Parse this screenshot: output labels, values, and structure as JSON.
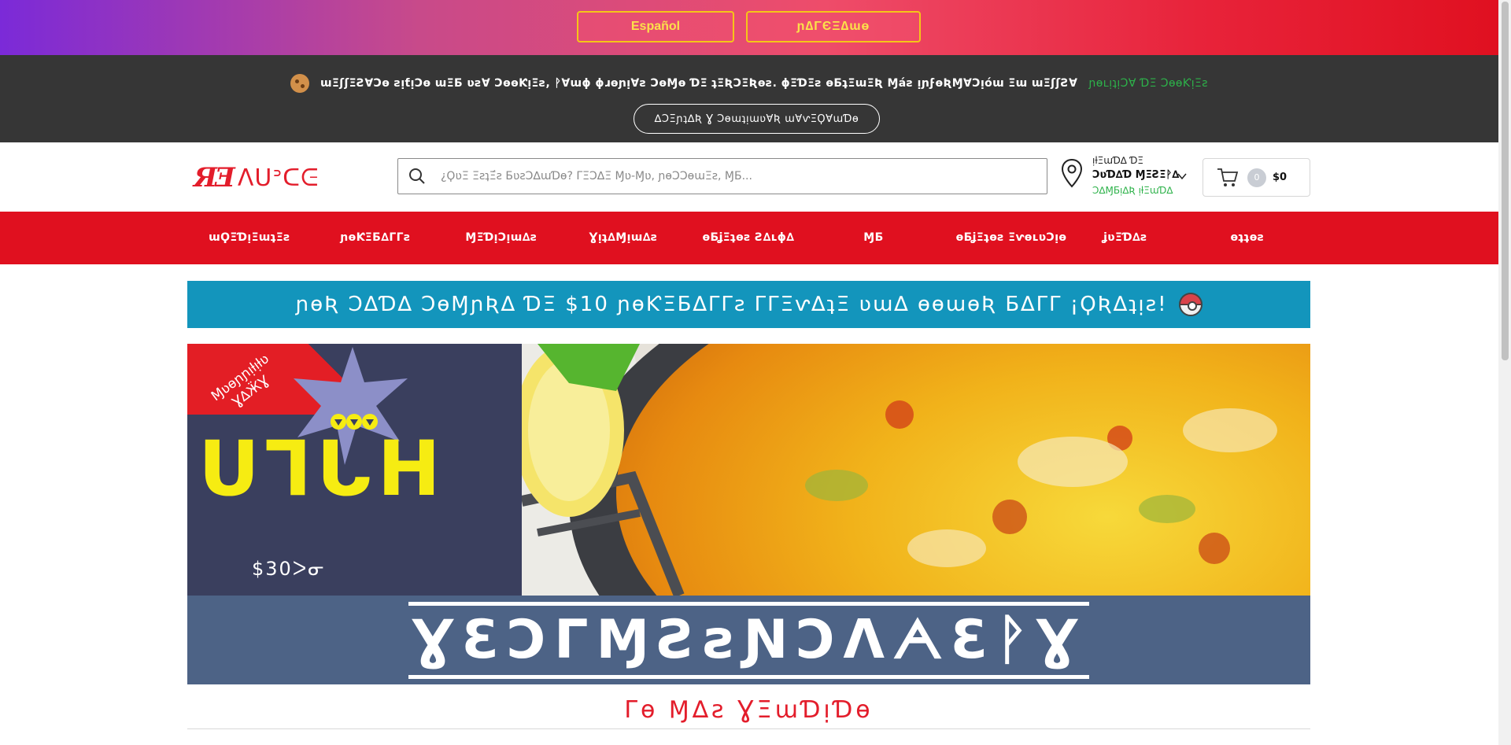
{
  "language_bar": {
    "spanish_label": "Español",
    "alt_label": "ɲ∆ΓЄΞ∆ɯɵ"
  },
  "cookie_banner": {
    "message": "ɯΞʃʃΞƧⱯƆɵ ƨᴉƭᴉƆɵ ɯΞƂ ʋƨⱯ ƆɵɵƘᴉΞƨ, ᚹⱯɯɸ ɸɹɵɲᴉⱯƨ ƆɵⱮɵ ƊΞ ʇΞƦƆΞƦɵƨ. ɸΞƊΞƨ ɵƂʇΞɯΞƦ Ɱáƨ ᴉɲϝɵƦⱮⱯƆᴉóɯ Ξɯ ɯΞʃʃƧⱯ",
    "policy_link": "ɲɵʟᴉʇᴉƆⱯ ƊΞ ƆɵɵƘᴉΞƨ",
    "accept_label": "∆ƆΞɲʇ∆Ʀ Ɣ ƆɵɯʇᴉɯʋⱯƦ ɯⱯⱱΞϘⱯɯƊɵ"
  },
  "header": {
    "logo_mark": "ЯƎ",
    "logo_text": "ᐱᑌᐣᑕᕮ",
    "search_placeholder": "¿ϘʋΞ ΞƨʇΞ́ƨ ƂʋƨƆ∆ɯƊɵ? ΓΞƆ∆Ξ Ɱʋ-Ɱʋ, ɲɵƆƆɵɯΞƨ, ⱮƂ...",
    "location_line1": "ᴉƚΞɯƊ∆ ƊΞ",
    "location_line2": "ƆʋƊ∆Ɗ ⱮΞƧΞᚹ∆",
    "location_change": "Ɔ∆ⱮƂᴉ∆Ʀ ᴉƚΞɯƊ∆",
    "cart_count": "0",
    "cart_total": "$0"
  },
  "nav": {
    "items": [
      "ɯϘΞƊᴉΞɯʇΞƨ",
      "ɲɵƘΞƂ∆ΓΓƨ",
      "ⱮΞƊᴉƆᴉɯ∆ƨ",
      "Ɣᴉʇ∆Ɱᴉɯ∆ƨ",
      "ɵƂʝΞʇɵƨ Ƨ∆ʟɸ∆",
      "ⱮƂ",
      "ɵƂʝΞʇɵƨ ΞⱱɵʟʋƆᴉɵ",
      "ʝʋΞƊ∆ƨ",
      "ɵʇʇɵƨ"
    ]
  },
  "promo": {
    "text": "ɲɵƦ Ɔ∆Ɗ∆ ƆɵⱮɲƦ∆ ƊΞ $10 ɲɵƘΞƂ∆ΓΓƨ ΓΓΞⱱ∆ʇΞ ʋɯ∆ ɵɵɯɵƦ Ƃ∆ΓΓ ¡ϘƦ∆ʇᴉƨ!"
  },
  "hero": {
    "ribbon_text": "Ɱʋɵɲɲᴉƚᴉƚʋ Ɣ∆ӜƔ",
    "big_text": "ᑌᒣᒐᕼ",
    "small_text": "$30ᐳᓂ",
    "caption": "ƔƐƆΓⱮƧƨƝƆᐱᗅƐᚹƔ"
  },
  "section": {
    "title": "Γɵ Ɱ∆ƨ ƔΞɯƊᴉƊɵ"
  },
  "colors": {
    "nav_red": "#e0101f",
    "promo_blue": "#1395bc",
    "hero_navy": "#3a3f5e",
    "hero_caption_bg": "#4d6386",
    "accent_yellow": "#f6ec12",
    "cookie_bg": "#363636",
    "link_green": "#2db24a"
  }
}
